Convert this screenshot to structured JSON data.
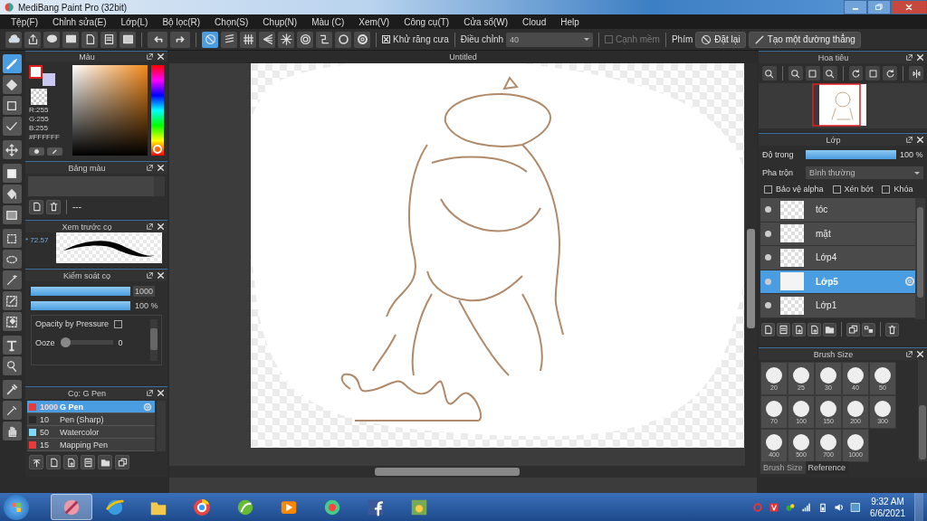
{
  "window": {
    "title": "MediBang Paint Pro (32bit)"
  },
  "menu": [
    "Tệp(F)",
    "Chỉnh sửa(E)",
    "Lớp(L)",
    "Bộ lọc(R)",
    "Chọn(S)",
    "Chụp(N)",
    "Màu (C)",
    "Xem(V)",
    "Công cụ(T)",
    "Cửa sổ(W)",
    "Cloud",
    "Help"
  ],
  "toolbar": {
    "snaps": [
      {
        "selected": true
      },
      {
        "selected": false
      },
      {
        "selected": false
      },
      {
        "selected": false
      },
      {
        "selected": false
      },
      {
        "selected": false
      },
      {
        "selected": false
      },
      {
        "selected": false
      }
    ],
    "antialias": {
      "label": "Khử răng cưa",
      "checked": true
    },
    "adjust": {
      "label": "Điều chỉnh",
      "value": "40"
    },
    "soft_edge": {
      "label": "Cạnh mềm",
      "checked": false
    },
    "keys_label": "Phím",
    "buttons": [
      "Đặt lại",
      "Tạo một đường thẳng"
    ]
  },
  "tools": [
    {
      "selected": true
    },
    {
      "selected": false
    },
    {
      "selected": false
    },
    {
      "selected": false
    },
    {
      "selected": false
    },
    {
      "selected": false
    },
    {
      "selected": false
    },
    {
      "selected": false
    },
    {
      "selected": false
    },
    {
      "selected": false
    },
    {
      "selected": false
    },
    {
      "selected": false
    },
    {
      "selected": false
    },
    {
      "selected": false
    },
    {
      "selected": false
    },
    {
      "selected": false
    },
    {
      "selected": false
    },
    {
      "selected": false
    }
  ],
  "color_panel": {
    "title": "Màu",
    "hue": {
      "level": 0
    },
    "readouts": [
      "R:255",
      "G:255",
      "B:255"
    ],
    "hex": "#FFFFFF"
  },
  "palette_panel": {
    "title": "Bảng màu",
    "palette_name": "---"
  },
  "brush_preview": {
    "title": "Xem trước cọ",
    "size": "* 72.57"
  },
  "brush_control": {
    "title": "Kiểm soát cọ",
    "size": {
      "level": 1,
      "reading": "1000"
    },
    "opacity": {
      "level": 1,
      "reading": "100 %"
    },
    "pressure": {
      "label": "Opacity by Pressure",
      "checked": false
    },
    "ooze": {
      "label": "Ooze",
      "level": 0,
      "reading": "0"
    }
  },
  "brushes": {
    "title": "Cọ: G Pen",
    "items": [
      {
        "size": "1000",
        "name": "G Pen",
        "color": "#e83a3a",
        "selected": true
      },
      {
        "size": "10",
        "name": "Pen (Sharp)",
        "color": "#2a2a2a",
        "selected": false
      },
      {
        "size": "50",
        "name": "Watercolor",
        "color": "#7fd8f5",
        "selected": false
      },
      {
        "size": "15",
        "name": "Mapping Pen",
        "color": "#e83a3a",
        "selected": false
      }
    ]
  },
  "canvas": {
    "tab": "Untitled"
  },
  "navigator": {
    "title": "Hoa tiêu"
  },
  "layers": {
    "title": "Lớp",
    "opacity": {
      "label": "Độ trong",
      "level": 1,
      "reading": "100 %"
    },
    "blend": {
      "label": "Pha trộn",
      "value": "Bình thường"
    },
    "options": [
      {
        "label": "Bảo vệ alpha",
        "checked": false
      },
      {
        "label": "Xén bớt",
        "checked": false
      },
      {
        "label": "Khóa",
        "checked": false
      }
    ],
    "items": [
      {
        "name": "tóc",
        "selected": false,
        "visible": true
      },
      {
        "name": "mặt",
        "selected": false,
        "visible": true
      },
      {
        "name": "Lớp4",
        "selected": false,
        "visible": true
      },
      {
        "name": "Lớp5",
        "selected": true,
        "visible": true
      },
      {
        "name": "Lớp1",
        "selected": false,
        "visible": true
      }
    ]
  },
  "brush_size": {
    "title": "Brush Size",
    "sizes": [
      "20",
      "25",
      "30",
      "40",
      "50",
      "70",
      "100",
      "150",
      "200",
      "300",
      "400",
      "500",
      "700",
      "1000"
    ],
    "tabs": [
      {
        "label": "Brush Size",
        "selected": true
      },
      {
        "label": "Reference",
        "selected": false
      }
    ]
  },
  "taskbar": {
    "apps": [
      {
        "selected": true
      },
      {
        "selected": false
      },
      {
        "selected": false
      },
      {
        "selected": false
      },
      {
        "selected": false
      },
      {
        "selected": false
      },
      {
        "selected": false
      },
      {
        "selected": false
      },
      {
        "selected": false
      }
    ],
    "time": "9:32 AM",
    "date": "6/6/2021"
  }
}
